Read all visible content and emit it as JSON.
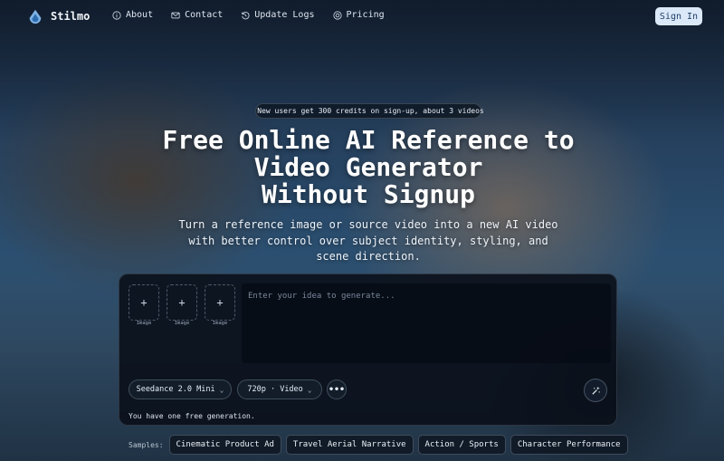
{
  "brand": {
    "name": "Stilmo",
    "logo_icon": "water-drop-logo-icon"
  },
  "nav": {
    "links": [
      {
        "label": "About",
        "icon": "info-icon"
      },
      {
        "label": "Contact",
        "icon": "mail-icon"
      },
      {
        "label": "Update Logs",
        "icon": "history-icon"
      },
      {
        "label": "Pricing",
        "icon": "coin-icon"
      }
    ],
    "signin_label": "Sign In"
  },
  "hero": {
    "promo": "New users get 300 credits on sign-up, about 3 videos",
    "title_line1": "Free Online AI Reference to",
    "title_line2": "Video Generator",
    "title_line3": "Without Signup",
    "subtitle": "Turn a reference image or source video into a new AI video with better control over subject identity, styling, and scene direction."
  },
  "composer": {
    "image_slots": [
      {
        "label": "Image",
        "icon": "plus-icon"
      },
      {
        "label": "Image",
        "icon": "plus-icon"
      },
      {
        "label": "Image",
        "icon": "plus-icon"
      }
    ],
    "prompt_placeholder": "Enter your idea to generate...",
    "model_select": "Seedance 2.0 Mini",
    "resolution_select": "720p · Video",
    "more_label": "•••",
    "free_note": "You have one free generation."
  },
  "samples": {
    "label": "Samples:",
    "items": [
      "Cinematic Product Ad",
      "Travel Aerial Narrative",
      "Action / Sports",
      "Character Performance"
    ]
  },
  "colors": {
    "accent": "#dbe8f8",
    "accent_text": "#1e3f66",
    "panel": "#0a101a"
  }
}
